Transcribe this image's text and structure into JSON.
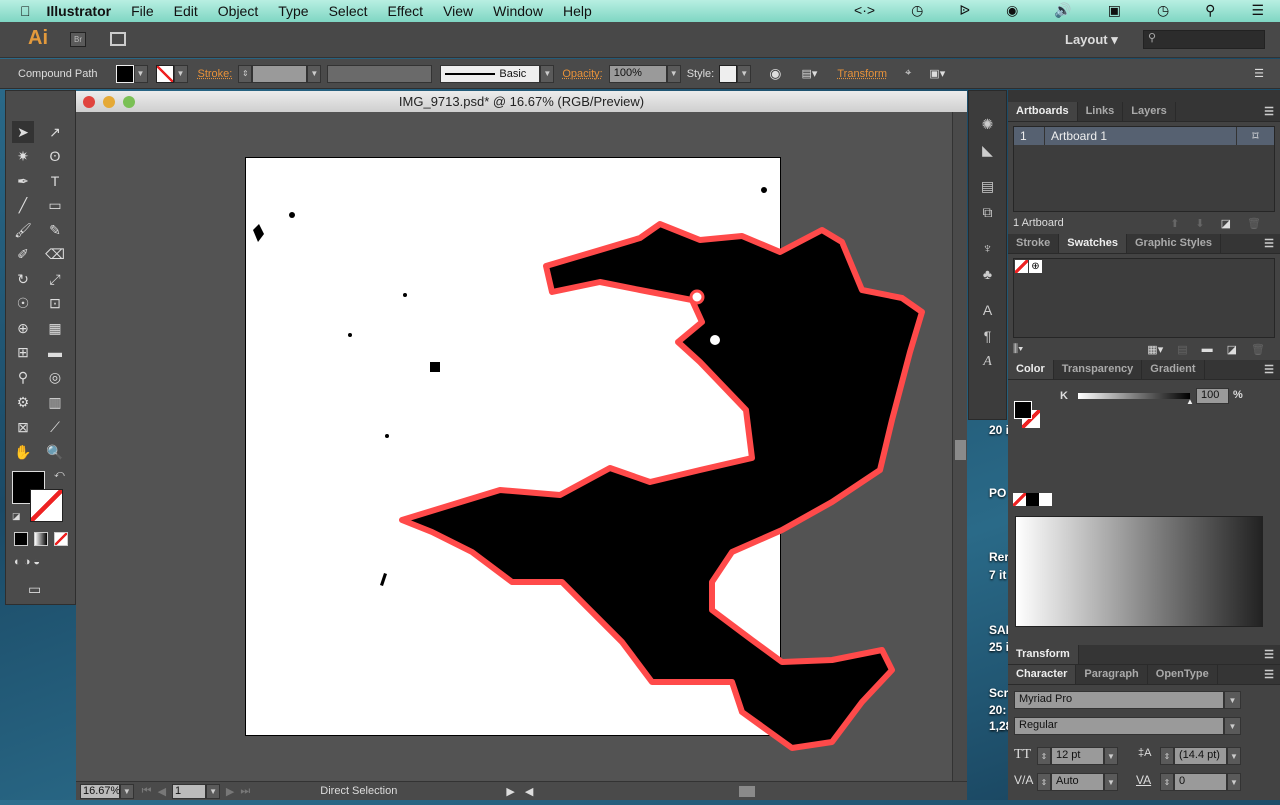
{
  "menubar": {
    "app": "Illustrator",
    "items": [
      "File",
      "Edit",
      "Object",
      "Type",
      "Select",
      "Effect",
      "View",
      "Window",
      "Help"
    ]
  },
  "appbar": {
    "logo": "Ai",
    "bridge": "Br",
    "workspace": "Layout",
    "search_placeholder": ""
  },
  "control": {
    "selection": "Compound Path",
    "stroke_label": "Stroke:",
    "brush": "Basic",
    "opacity_label": "Opacity:",
    "opacity": "100%",
    "style_label": "Style:",
    "transform_label": "Transform"
  },
  "document": {
    "title": "IMG_9713.psd* @ 16.67% (RGB/Preview)",
    "zoom": "16.67%",
    "artboard_nav": "1",
    "status": "Direct Selection"
  },
  "artboards_panel": {
    "tabs": [
      "Artboards",
      "Links",
      "Layers"
    ],
    "rows": [
      {
        "num": "1",
        "name": "Artboard 1"
      }
    ],
    "footer": "1 Artboard"
  },
  "swatches_panel": {
    "tabs": [
      "Stroke",
      "Swatches",
      "Graphic Styles"
    ]
  },
  "color_panel": {
    "tabs": [
      "Color",
      "Transparency",
      "Gradient"
    ],
    "channel": "K",
    "value": "100",
    "unit": "%"
  },
  "transform_panel": {
    "tab": "Transform"
  },
  "character_panel": {
    "tabs": [
      "Character",
      "Paragraph",
      "OpenType"
    ],
    "font": "Myriad Pro",
    "style": "Regular",
    "size": "12 pt",
    "leading": "(14.4 pt)",
    "kerning": "Auto",
    "tracking": "0"
  },
  "desktop": [
    "20 i",
    "PO",
    "Rer",
    "7 it",
    "SAI",
    "25 i",
    "Scr",
    "20:",
    "1,28"
  ],
  "colors": {
    "selection_outline": "#ff4a4a",
    "artwork": "#000000"
  }
}
